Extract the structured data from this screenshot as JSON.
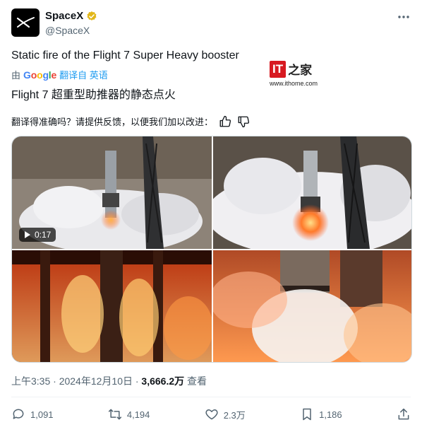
{
  "author": {
    "name": "SpaceX",
    "handle": "@SpaceX"
  },
  "post": {
    "text_en": "Static fire of the Flight 7 Super Heavy booster",
    "translate_prefix": "由",
    "translate_brand": "Google",
    "translate_link": "翻译自 英语",
    "text_zh": "Flight 7 超重型助推器的静态点火",
    "feedback_label": "翻译得准确吗？请提供反馈，以便我们加以改进："
  },
  "watermark": {
    "logo_zh": "之家",
    "url": "www.ithome.com"
  },
  "media": {
    "video_duration": "0:17"
  },
  "meta": {
    "time": "上午3:35 · 2024年12月10日 · ",
    "views": "3,666.2万",
    "views_label": " 查看"
  },
  "actions": {
    "replies": "1,091",
    "reposts": "4,194",
    "likes": "2.3万",
    "bookmarks": "1,186"
  },
  "colors": {
    "verified": "#e2b719",
    "link": "#1d9bf0",
    "muted": "#536471"
  },
  "icons": [
    "spacex-logo-icon",
    "verified-badge-icon",
    "more-icon",
    "thumbs-up-icon",
    "thumbs-down-icon",
    "play-icon",
    "reply-icon",
    "repost-icon",
    "like-icon",
    "bookmark-icon",
    "share-icon"
  ]
}
